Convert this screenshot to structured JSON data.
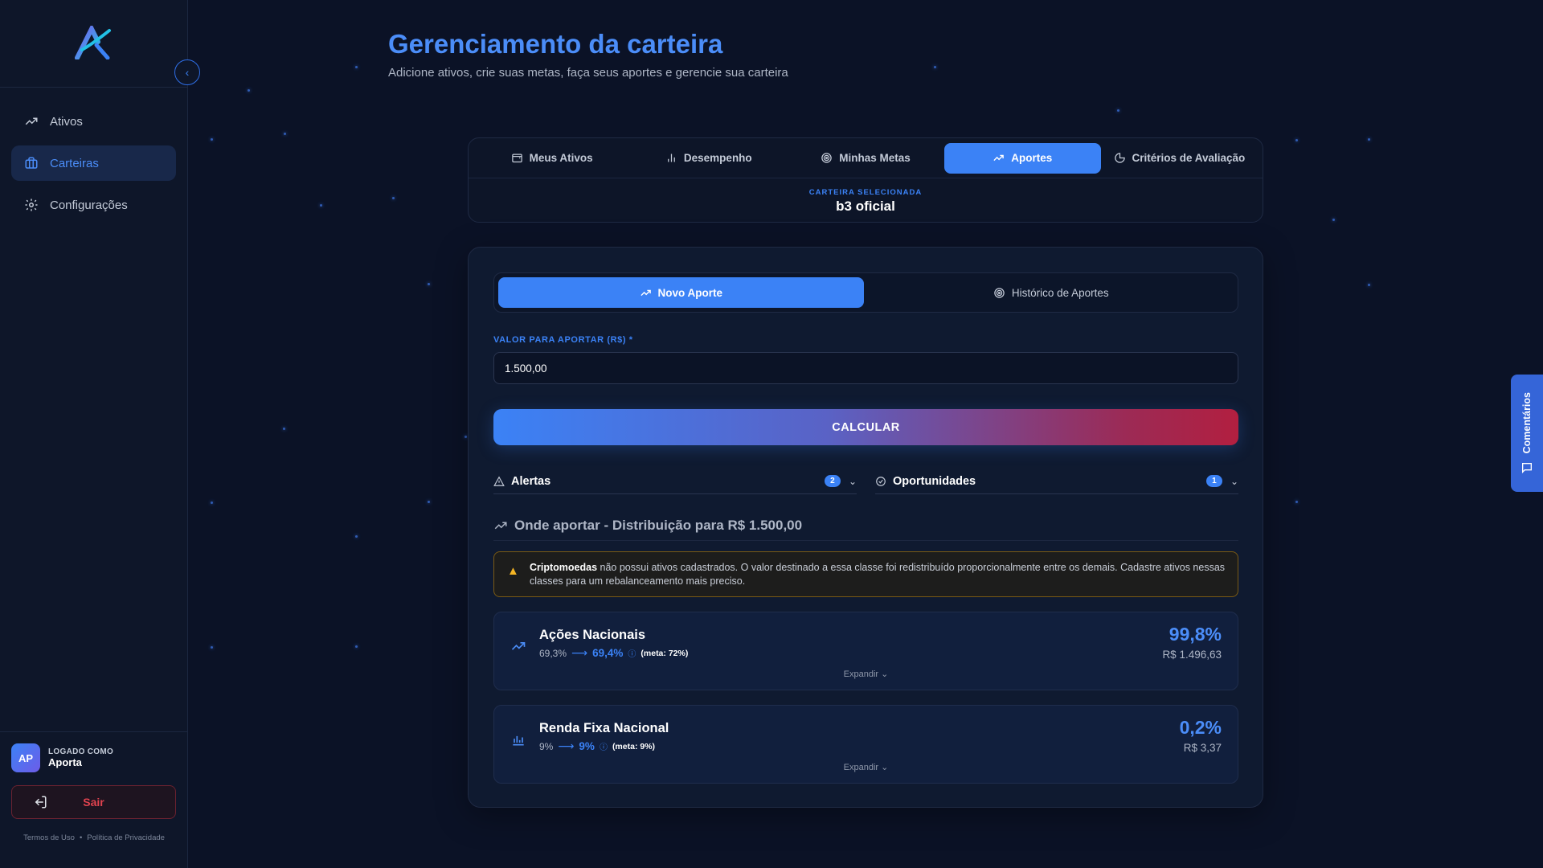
{
  "sidebar": {
    "items": [
      {
        "label": "Ativos",
        "icon": "trending-up-icon"
      },
      {
        "label": "Carteiras",
        "icon": "briefcase-icon"
      },
      {
        "label": "Configurações",
        "icon": "gear-icon"
      }
    ],
    "user": {
      "initials": "AP",
      "logged_label": "LOGADO COMO",
      "name": "Aporta"
    },
    "logout_label": "Sair",
    "footer": {
      "terms": "Termos de Uso",
      "separator": "•",
      "privacy": "Política de Privacidade"
    }
  },
  "header": {
    "title": "Gerenciamento da carteira",
    "subtitle": "Adicione ativos, crie suas metas, faça seus aportes e gerencie sua carteira"
  },
  "tabs": [
    {
      "label": "Meus Ativos",
      "icon": "wallet-icon"
    },
    {
      "label": "Desempenho",
      "icon": "bar-chart-icon"
    },
    {
      "label": "Minhas Metas",
      "icon": "target-icon"
    },
    {
      "label": "Aportes",
      "icon": "trending-up-icon",
      "active": true
    },
    {
      "label": "Critérios de Avaliação",
      "icon": "pie-chart-icon"
    }
  ],
  "selected_wallet": {
    "label": "CARTEIRA SELECIONADA",
    "value": "b3 oficial"
  },
  "subtabs": [
    {
      "label": "Novo Aporte",
      "active": true
    },
    {
      "label": "Histórico de Aportes"
    }
  ],
  "form": {
    "label": "VALOR PARA APORTAR (R$) *",
    "value": "1.500,00",
    "calculate_label": "CALCULAR"
  },
  "accordions": {
    "alertas": {
      "title": "Alertas",
      "count": "2"
    },
    "oportunidades": {
      "title": "Oportunidades",
      "count": "1"
    }
  },
  "distribution": {
    "title": "Onde aportar - Distribuição para R$ 1.500,00",
    "warning_bold": "Criptomoedas",
    "warning_text": " não possui ativos cadastrados. O valor destinado a essa classe foi redistribuído proporcionalmente entre os demais. Cadastre ativos nessas classes para um rebalanceamento mais preciso.",
    "assets": [
      {
        "name": "Ações Nacionais",
        "from": "69,3%",
        "to": "69,4%",
        "meta": "(meta: 72%)",
        "pct": "99,8%",
        "value": "R$ 1.496,63",
        "expand": "Expandir"
      },
      {
        "name": "Renda Fixa Nacional",
        "from": "9%",
        "to": "9%",
        "meta": "(meta: 9%)",
        "pct": "0,2%",
        "value": "R$ 3,37",
        "expand": "Expandir"
      }
    ]
  },
  "comments_label": "Comentários",
  "colors": {
    "accent": "#3b82f6",
    "background": "#0b1226",
    "warning": "#f5b524",
    "danger": "#e0434f"
  }
}
